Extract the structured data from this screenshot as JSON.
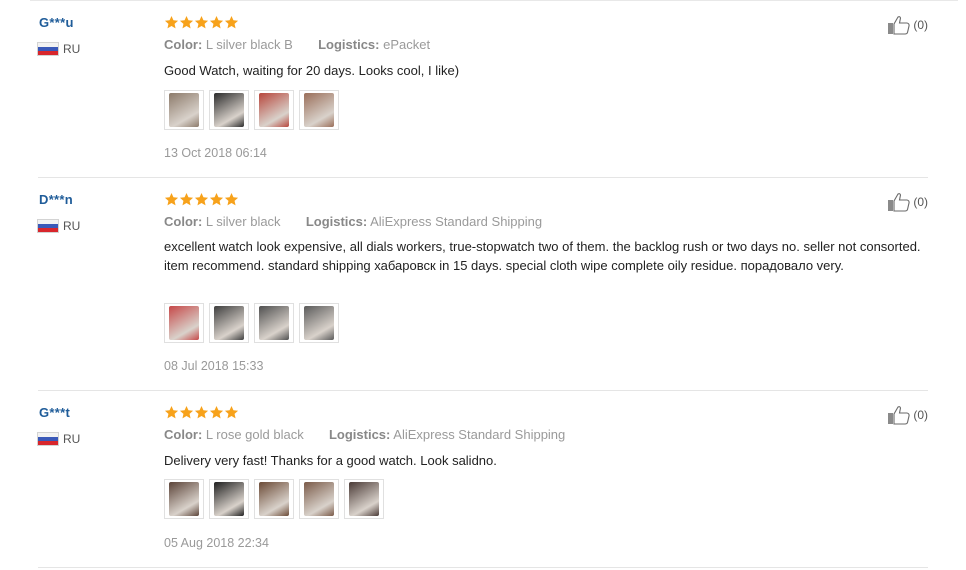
{
  "reviews": [
    {
      "buyer": "G***u",
      "country": "RU",
      "rating": 5,
      "attrs": [
        {
          "label": "Color:",
          "value": "L silver black B"
        },
        {
          "label": "Logistics:",
          "value": "ePacket"
        }
      ],
      "text": "Good Watch, waiting for 20 days. Looks cool, I like)",
      "photos": [
        "#8c7a6a",
        "#2b2b2b",
        "#b7463c",
        "#9a6e59"
      ],
      "date": "13 Oct 2018 06:14",
      "helpful": "(0)"
    },
    {
      "buyer": "D***n",
      "country": "RU",
      "rating": 5,
      "attrs": [
        {
          "label": "Color:",
          "value": "L silver black"
        },
        {
          "label": "Logistics:",
          "value": "AliExpress Standard Shipping"
        }
      ],
      "text": "excellent watch look expensive, all dials workers, true-stopwatch two of them. the backlog rush or two days no. seller not consorted. item recommend. standard shipping хабаровск in 15 days. special cloth wipe complete oily residue. порадовало very.",
      "photos": [
        "#c64848",
        "#3e3e3e",
        "#4f4f4f",
        "#5a5a5a"
      ],
      "date": "08 Jul 2018 15:33",
      "helpful": "(0)"
    },
    {
      "buyer": "G***t",
      "country": "RU",
      "rating": 5,
      "attrs": [
        {
          "label": "Color:",
          "value": "L rose gold black"
        },
        {
          "label": "Logistics:",
          "value": "AliExpress Standard Shipping"
        }
      ],
      "text": "Delivery very fast! Thanks for a good watch. Look salidno.",
      "photos": [
        "#5b4338",
        "#1f1f1f",
        "#6b4a36",
        "#7a5a48",
        "#4a3a36"
      ],
      "date": "05 Aug 2018 22:34",
      "helpful": "(0)"
    }
  ],
  "colors": {
    "star": "#f7a21b",
    "buyer_name": "#1f5c99",
    "muted": "#999999"
  },
  "icons": {
    "flag": "russia-flag-icon",
    "star": "star-icon",
    "like": "thumbs-up-icon"
  }
}
